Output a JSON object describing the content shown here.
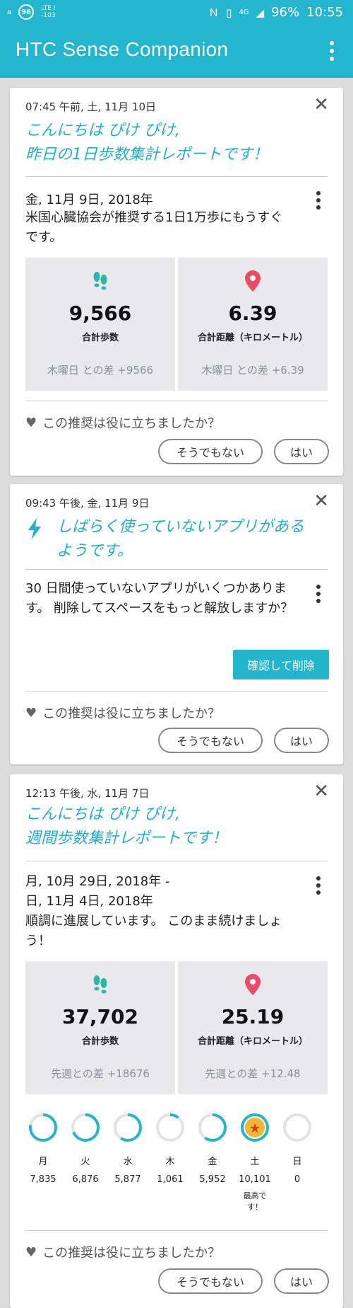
{
  "status_bar": {
    "badge_left": "96",
    "signal_top": "LTE I",
    "signal_bottom": "-103",
    "nfc_icon": "nfc-icon",
    "vibrate_icon": "vibrate-icon",
    "network_label": "4G",
    "battery": "96%",
    "time": "10:55"
  },
  "app_bar": {
    "title": "HTC Sense Companion"
  },
  "cards": [
    {
      "time": "07:45 午前, 土, 11月 10日",
      "heading_line1": "こんにちは ぴけ ぴけ,",
      "heading_line2": "昨日の1日歩数集計レポートです！",
      "date": "金, 11月 9日, 2018年",
      "message": "米国心臓協会が推奨する1日1万歩にもうすぐです。",
      "steps": {
        "value": "9,566",
        "label": "合計歩数",
        "diff": "木曜日 との差 +9566"
      },
      "distance": {
        "value": "6.39",
        "label": "合計距離（キロメートル）",
        "diff": "木曜日 との差 +6.39"
      },
      "feedback_question": "この推奨は役に立ちましたか？",
      "no_label": "そうでもない",
      "yes_label": "はい"
    },
    {
      "time": "09:43 午後, 金, 11月 9日",
      "heading_line1": "しばらく使っていないアプリがある",
      "heading_line2": "ようです。",
      "message": "30 日間使っていないアプリがいくつかあります。 削除してスペースをもっと解放しますか？",
      "action_label": "確認して削除",
      "feedback_question": "この推奨は役に立ちましたか？",
      "no_label": "そうでもない",
      "yes_label": "はい"
    },
    {
      "time": "12:13 午後, 水, 11月 7日",
      "heading_line1": "こんにちは ぴけ ぴけ,",
      "heading_line2": "週間歩数集計レポートです！",
      "date_line1": "月, 10月 29日, 2018年 -",
      "date_line2": "日, 11月 4日, 2018年",
      "message": "順調に進展しています。 このまま続けましょう！",
      "steps": {
        "value": "37,702",
        "label": "合計歩数",
        "diff": "先週との差 +18676"
      },
      "distance": {
        "value": "25.19",
        "label": "合計距離（キロメートル）",
        "diff": "先週との差 +12.48"
      },
      "days": [
        {
          "name": "月",
          "value": "7,835",
          "progress": 0.78
        },
        {
          "name": "火",
          "value": "6,876",
          "progress": 0.69
        },
        {
          "name": "水",
          "value": "5,877",
          "progress": 0.59
        },
        {
          "name": "木",
          "value": "1,061",
          "progress": 0.11
        },
        {
          "name": "金",
          "value": "5,952",
          "progress": 0.6
        },
        {
          "name": "土",
          "value": "10,101",
          "progress": 1.0,
          "note": "最高です！"
        },
        {
          "name": "日",
          "value": "0",
          "progress": 0
        }
      ],
      "feedback_question": "この推奨は役に立ちましたか？",
      "no_label": "そうでもない",
      "yes_label": "はい"
    }
  ],
  "colors": {
    "accent": "#24b6cf",
    "step_icon": "#2bb7a6",
    "pin_icon": "#ee4a68",
    "star_bg": "#f2b632",
    "ring_track": "#e3e3e3"
  }
}
